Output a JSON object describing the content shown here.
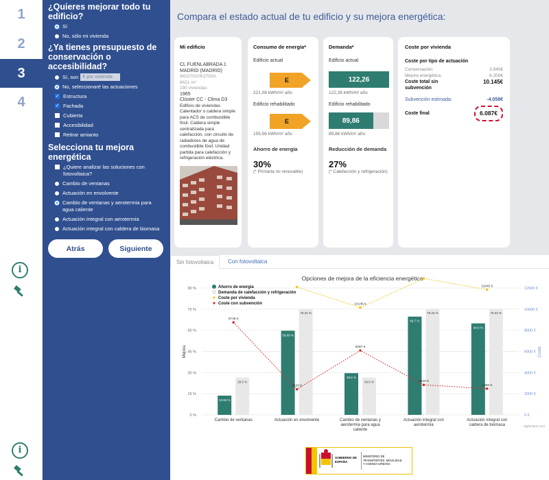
{
  "steps": [
    "1",
    "2",
    "3",
    "4"
  ],
  "sidebar": {
    "q1": "¿Quieres mejorar todo tu edificio?",
    "q1_options": [
      "Sí",
      "No, sólo mi vivienda"
    ],
    "q2": "¿Ya tienes presupuesto de conservación o accesibilidad?",
    "q2_opt_yes": "Sí, son",
    "per_vivienda_placeholder": "€ por vivienda",
    "q2_opt_no": "No, seleccionaré las actuaciones",
    "checks": [
      "Estructura",
      "Fachada",
      "Cubierta",
      "Accesibilidad",
      "Retirar amianto"
    ],
    "q3": "Selecciona tu mejora energética",
    "q3_check": "¿Quiere analizar las soluciones con fotovoltaica?",
    "q3_options": [
      "Cambio de ventanas",
      "Actuación en envolvente",
      "Cambio de ventanas y aerotermia para agua caliente",
      "Actuación integral con aerotermia",
      "Actuación integral con caldera de biomasa"
    ],
    "back": "Atrás",
    "next": "Siguiente"
  },
  "main": {
    "title": "Compara el estado actual de tu edificio y su mejora energética:",
    "building": {
      "title": "Mi edificio",
      "address1": "CL FUENLABRADA 1",
      "address2": "MADRID (MADRID)",
      "ref": "9422701VK3792A",
      "area": "8421 m²",
      "viviendas": "190 viviendas",
      "year": "1965",
      "cluster": "Clúster CC - Clima D3",
      "desc": "Edificio de viviendas Calentador o caldera simple para ACS de combustible fósil. Caldera simple centralizada para calefacción, con circuito de radiadores de agua de combustible fósil. Unidad partida para calefacción y refrigeración eléctrica."
    },
    "consumo": {
      "title": "Consumo de energía*",
      "actual_label": "Edificio actual",
      "actual_class": "E",
      "actual_value": "221,08 kWh/m² año",
      "rehab_label": "Edificio rehabilitado",
      "rehab_class": "E",
      "rehab_value": "155,56 kWh/m² año",
      "ahorro_title": "Ahorro de energía",
      "ahorro_value": "30%",
      "ahorro_note": "(* Primaria no renovable)"
    },
    "demanda": {
      "title": "Demanda*",
      "actual_label": "Edificio actual",
      "actual_value": "122,26",
      "actual_unit": "122,26 kWh/m² año",
      "actual_fill": 1.0,
      "rehab_label": "Edificio rehabilitado",
      "rehab_value": "89,86",
      "rehab_unit": "89,86 kWh/m² año",
      "rehab_fill": 0.735,
      "reduccion_title": "Reducción de demanda",
      "reduccion_value": "27%",
      "reduccion_note": "(* Calefacción y refrigeración)"
    },
    "coste": {
      "title": "Coste por vivienda",
      "subtitle": "Coste por tipo de actuación",
      "rows": [
        {
          "label": "Conservación:",
          "value": "3.945€"
        },
        {
          "label": "Mejora energética:",
          "value": "6.200€"
        }
      ],
      "total_label": "Coste total sin subvención",
      "total_value": "10.145€",
      "subv_label": "Subvención estimada:",
      "subv_value": "-4.058€",
      "final_label": "Coste final",
      "final_value": "6.087€"
    },
    "tabs": [
      "Sin fotovoltaica",
      "Con fotovoltaica"
    ]
  },
  "chart_data": {
    "type": "bar",
    "title": "Opciones de mejora de la eficiencia energética",
    "categories": [
      "Cambio de ventanas",
      "Actuación en envolvente",
      "Cambio de ventanas y aerotermia para agua caliente",
      "Actuación integral con aerotermia",
      "Actuación integral con caldera de biomasa"
    ],
    "y_ticks": [
      "0 %",
      "15 %",
      "30 %",
      "45 %",
      "60 %",
      "75 %",
      "90 %"
    ],
    "y2_ticks": [
      "0 €",
      "2000 €",
      "4000 €",
      "6000 €",
      "8000 €",
      "10000 €",
      "12000 €"
    ],
    "ylabel": "Mejora",
    "y2label": "Coste",
    "ylim": [
      0,
      90
    ],
    "y2lim": [
      0,
      12000
    ],
    "series": [
      {
        "name": "Ahorro de energía",
        "type": "bar",
        "color": "#2e7d70",
        "values": [
          13.65,
          59.69,
          29.6,
          69.7,
          64.9
        ],
        "labels": [
          "13.65 %",
          "59.69 %",
          "29.6 %",
          "69.7 %",
          "64.9 %"
        ]
      },
      {
        "name": "Demanda de calefacción y refrigeración",
        "type": "bar",
        "color": "#e8e8e8",
        "values": [
          26.5,
          75.34,
          26.5,
          75.34,
          75.34
        ],
        "labels": [
          "26.5 %",
          "75.34 %",
          "26.5 %",
          "75.34 %",
          "75.34 %"
        ]
      },
      {
        "name": "Coste por vivienda",
        "type": "line",
        "color": "#f5c518",
        "values": [
          null,
          12100,
          10145,
          12900,
          11845
        ],
        "labels": [
          "",
          "",
          "10145 €",
          "",
          "11845 €"
        ]
      },
      {
        "name": "Coste con subvención",
        "type": "line",
        "color": "#d63031",
        "values": [
          8745,
          2420,
          6087,
          2840,
          2480
        ],
        "labels": [
          "8745 €",
          "2420 €",
          "6087 €",
          "2840 €",
          "2480 €"
        ]
      }
    ],
    "credits": "Highcharts.com"
  },
  "footer": {
    "logo_text1": "GOBIERNO DE ESPAÑA",
    "logo_text2": "MINISTERIO DE TRANSPORTES, MOVILIDAD Y AGENDA URBANA"
  },
  "colors": {
    "primary": "#2f4f8f",
    "green": "#2e7d70",
    "orange": "#f0a326"
  }
}
